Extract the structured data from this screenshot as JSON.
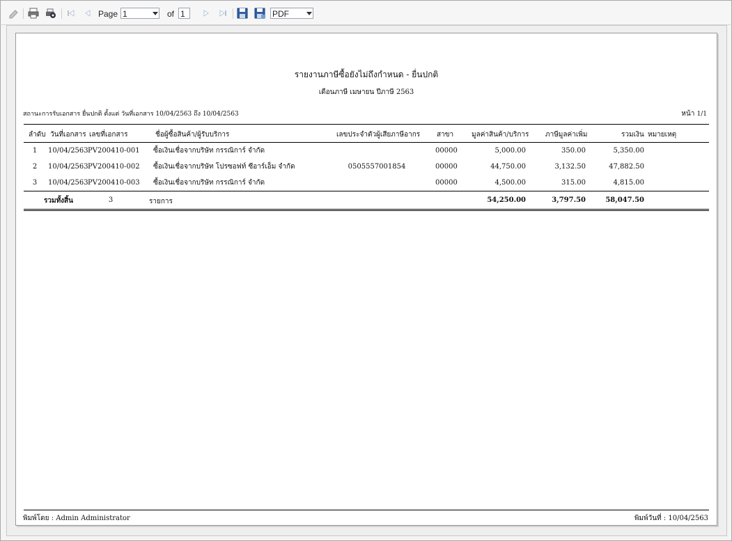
{
  "toolbar": {
    "page_label": "Page",
    "page_value": "1",
    "of_label": "of",
    "total_pages": "1",
    "export_format": "PDF",
    "icons": [
      "edit-icon",
      "print-icon",
      "print-setup-icon",
      "first-page-icon",
      "prev-page-icon",
      "next-page-icon",
      "last-page-icon",
      "save-icon",
      "save-as-icon"
    ]
  },
  "report": {
    "title": "รายงานภาษีซื้อยังไม่ถึงกำหนด - ยื่นปกติ",
    "subtitle": "เดือนภาษี เมษายน ปีภาษี 2563",
    "criteria": "สถานะการรับเอกสาร ยื่นปกติ ตั้งแต่  วันที่เอกสาร  10/04/2563  ถึง  10/04/2563",
    "page_label": "หน้า",
    "page_value": "1/1",
    "columns": {
      "seq": "ลำดับ",
      "date": "วันที่เอกสาร",
      "doc_no": "เลขที่เอกสาร",
      "vendor": "ชื่อผู้ซื้อสินค้า/ผู้รับบริการ",
      "tax_id": "เลขประจำตัวผู้เสียภาษีอากร",
      "branch": "สาขา",
      "amount": "มูลค่าสินค้า/บริการ",
      "vat": "ภาษีมูลค่าเพิ่ม",
      "total": "รวมเงิน",
      "note": "หมายเหตุ"
    },
    "rows": [
      {
        "seq": "1",
        "date": "10/04/2563",
        "doc_no": "PV200410-001",
        "vendor": "ซื้อเงินเชื่อจากบริษัท กรรณิการ์ จำกัด",
        "tax_id": "",
        "branch": "00000",
        "amount": "5,000.00",
        "vat": "350.00",
        "total": "5,350.00"
      },
      {
        "seq": "2",
        "date": "10/04/2563",
        "doc_no": "PV200410-002",
        "vendor": "ซื้อเงินเชื่อจากบริษัท โปรซอฟท์ ซีอาร์เอ็ม จำกัด",
        "tax_id": "0505557001854",
        "branch": "00000",
        "amount": "44,750.00",
        "vat": "3,132.50",
        "total": "47,882.50"
      },
      {
        "seq": "3",
        "date": "10/04/2563",
        "doc_no": "PV200410-003",
        "vendor": "ซื้อเงินเชื่อจากบริษัท กรรณิการ์ จำกัด",
        "tax_id": "",
        "branch": "00000",
        "amount": "4,500.00",
        "vat": "315.00",
        "total": "4,815.00"
      }
    ],
    "summary": {
      "label": "รวมทั้งสิ้น",
      "count": "3",
      "unit": "รายการ",
      "amount": "54,250.00",
      "vat": "3,797.50",
      "total": "58,047.50"
    },
    "footer": {
      "printed_by": "พิมพ์โดย :  Admin Administrator",
      "printed_date": "พิมพ์วันที่ :  10/04/2563"
    }
  }
}
